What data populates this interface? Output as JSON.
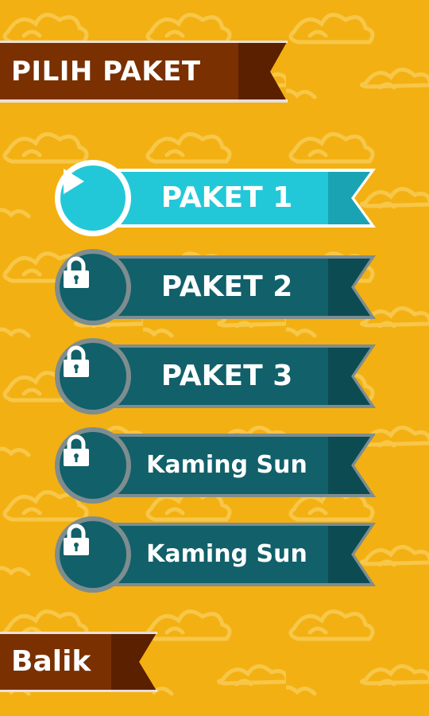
{
  "header": {
    "title": "PILIH PAKET"
  },
  "packages": [
    {
      "label": "PAKET 1",
      "state": "unlocked",
      "icon": "play-icon"
    },
    {
      "label": "PAKET 2",
      "state": "locked",
      "icon": "lock-icon"
    },
    {
      "label": "PAKET 3",
      "state": "locked",
      "icon": "lock-icon"
    },
    {
      "label": "Kaming Sun",
      "state": "locked",
      "icon": "lock-icon"
    },
    {
      "label": "Kaming Sun",
      "state": "locked",
      "icon": "lock-icon"
    }
  ],
  "footer": {
    "back_label": "Balik"
  },
  "colors": {
    "background": "#f3b012",
    "ribbon_brown": "#7a3000",
    "ribbon_brown_dark": "#5a2000",
    "active_teal": "#23c8d8",
    "locked_teal": "#11606a"
  }
}
